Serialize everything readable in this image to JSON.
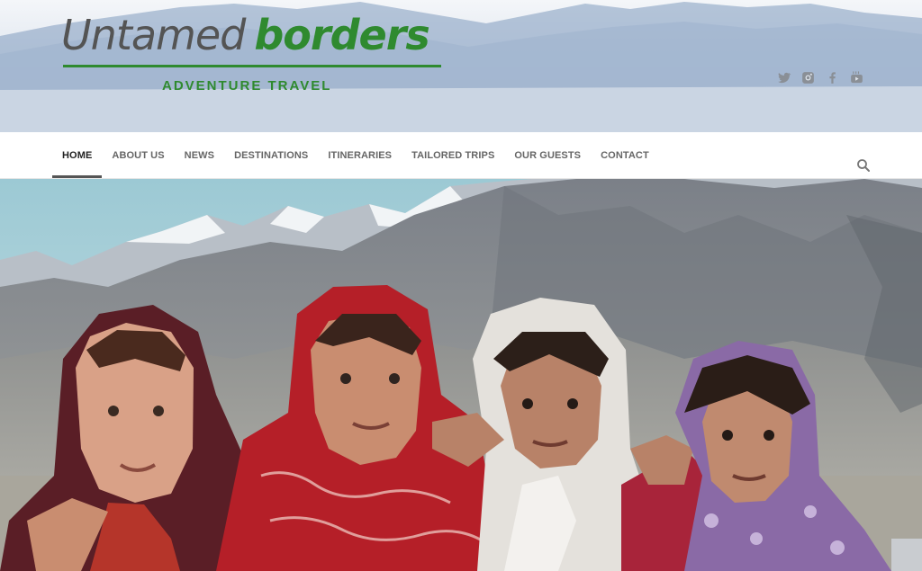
{
  "brand": {
    "name_part1": "Untamed",
    "name_part2": "borders",
    "tagline": "ADVENTURE TRAVEL",
    "green": "#2f8a2f",
    "grey": "#545454"
  },
  "social": [
    {
      "icon": "twitter-icon"
    },
    {
      "icon": "instagram-icon"
    },
    {
      "icon": "facebook-icon"
    },
    {
      "icon": "youtube-icon"
    }
  ],
  "nav": {
    "items": [
      {
        "label": "HOME",
        "active": true
      },
      {
        "label": "ABOUT US"
      },
      {
        "label": "NEWS"
      },
      {
        "label": "DESTINATIONS"
      },
      {
        "label": "ITINERARIES"
      },
      {
        "label": "TAILORED TRIPS"
      },
      {
        "label": "OUR GUESTS"
      },
      {
        "label": "CONTACT"
      }
    ],
    "search_icon": "search-icon"
  },
  "hero": {
    "image": "four-girls-in-headscarves-mountain-landscape"
  }
}
